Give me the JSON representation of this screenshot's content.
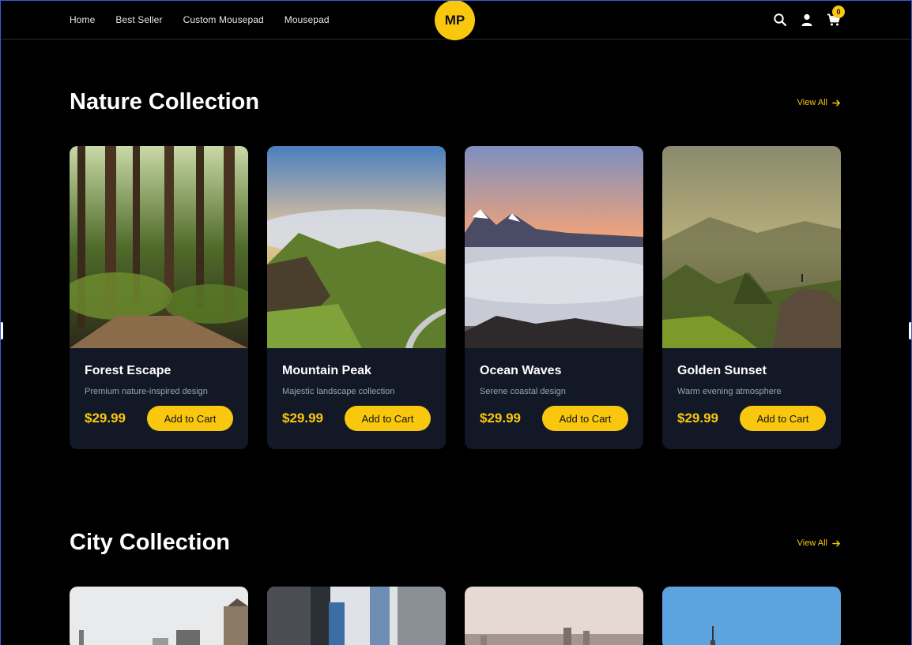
{
  "nav": {
    "items": [
      "Home",
      "Best Seller",
      "Custom Mousepad",
      "Mousepad"
    ],
    "logo": "MP",
    "cart_count": "0"
  },
  "nature": {
    "title": "Nature Collection",
    "view_all": "View All",
    "products": [
      {
        "title": "Forest Escape",
        "desc": "Premium nature-inspired design",
        "price": "$29.99",
        "button": "Add to Cart"
      },
      {
        "title": "Mountain Peak",
        "desc": "Majestic landscape collection",
        "price": "$29.99",
        "button": "Add to Cart"
      },
      {
        "title": "Ocean Waves",
        "desc": "Serene coastal design",
        "price": "$29.99",
        "button": "Add to Cart"
      },
      {
        "title": "Golden Sunset",
        "desc": "Warm evening atmosphere",
        "price": "$29.99",
        "button": "Add to Cart"
      }
    ]
  },
  "city": {
    "title": "City Collection",
    "view_all": "View All"
  },
  "colors": {
    "accent": "#f9c80e",
    "card_bg": "#121826",
    "page_bg": "#000000"
  }
}
